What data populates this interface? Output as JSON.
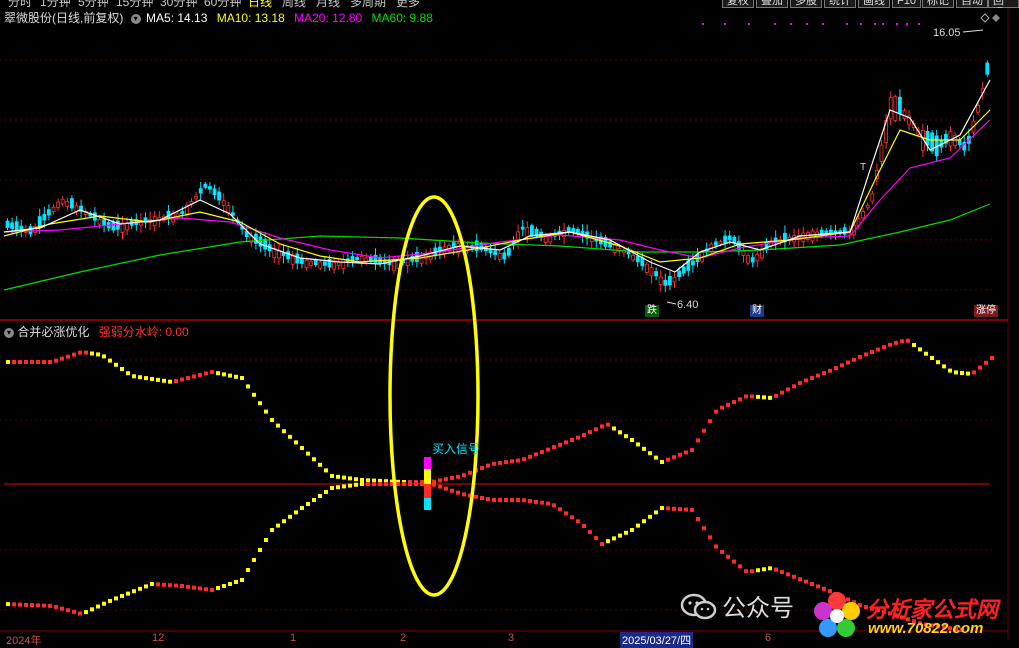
{
  "stock_title": "翠微股份(日线,前复权)",
  "ma_legend": [
    {
      "label": "MA5: 14.13",
      "color": "#ffffff"
    },
    {
      "label": "MA10: 13.18",
      "color": "#ffff00"
    },
    {
      "label": "MA20: 12.80",
      "color": "#ff00ff"
    },
    {
      "label": "MA60: 9.88",
      "color": "#00e000"
    }
  ],
  "indicator_name": "合并必涨优化",
  "indicator_param": "强弱分水岭: 0.00",
  "price_high_label": "16.05",
  "price_low_label": "6.40",
  "marker_die": "跌",
  "marker_cai": "财",
  "marker_right": "涨停",
  "buy_signal_label": "买入信号",
  "date_labels": [
    "2024年",
    "12",
    "1",
    "2",
    "3",
    "2025/03/27/四",
    "6"
  ],
  "watermark_text": "公众号",
  "brand_text": "分析家公式网",
  "brand_url": "www.70822.com",
  "toolbar_items": [
    "分时",
    "1分钟",
    "5分钟",
    "15分钟",
    "30分钟",
    "60分钟",
    "日线",
    "周线",
    "月线",
    "多周期",
    "更多"
  ],
  "toolbar_buttons": [
    "复权",
    "叠加",
    "多股",
    "统计",
    "画线",
    "F10",
    "标记",
    "自动",
    "回退"
  ],
  "colors": {
    "up": "#ff3030",
    "down": "#00e5ff",
    "yellow": "#ffff00",
    "magenta": "#ff00ff",
    "green": "#00e000",
    "separator": "#b00000"
  }
}
